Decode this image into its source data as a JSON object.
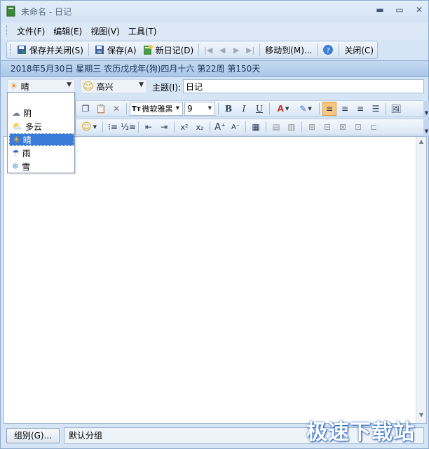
{
  "window": {
    "title": "未命名 - 日记",
    "minimize": "▬",
    "maximize": "▭",
    "close": "✕"
  },
  "menu": [
    "文件(F)",
    "编辑(E)",
    "视图(V)",
    "工具(T)"
  ],
  "toolbar": {
    "save_close": "保存并关闭(S)",
    "save": "保存(A)",
    "new_diary": "新日记(D)",
    "move_to": "移动到(M)...",
    "close": "关闭(C)"
  },
  "status_line": "2018年5月30日  星期三  农历戊戌年(狗)四月十六   第22周  第150天",
  "weather": {
    "selected": "晴",
    "options": [
      "阴",
      "多云",
      "晴",
      "雨",
      "雪"
    ]
  },
  "mood": {
    "selected": "高兴"
  },
  "subject": {
    "label": "主题(I):",
    "value": "日记"
  },
  "format": {
    "font": "微软雅黑",
    "size": "9",
    "bold": "B",
    "italic": "I",
    "underline": "U"
  },
  "group": {
    "button": "组别(G)...",
    "value": "默认分组"
  },
  "watermark": "极速下载站"
}
